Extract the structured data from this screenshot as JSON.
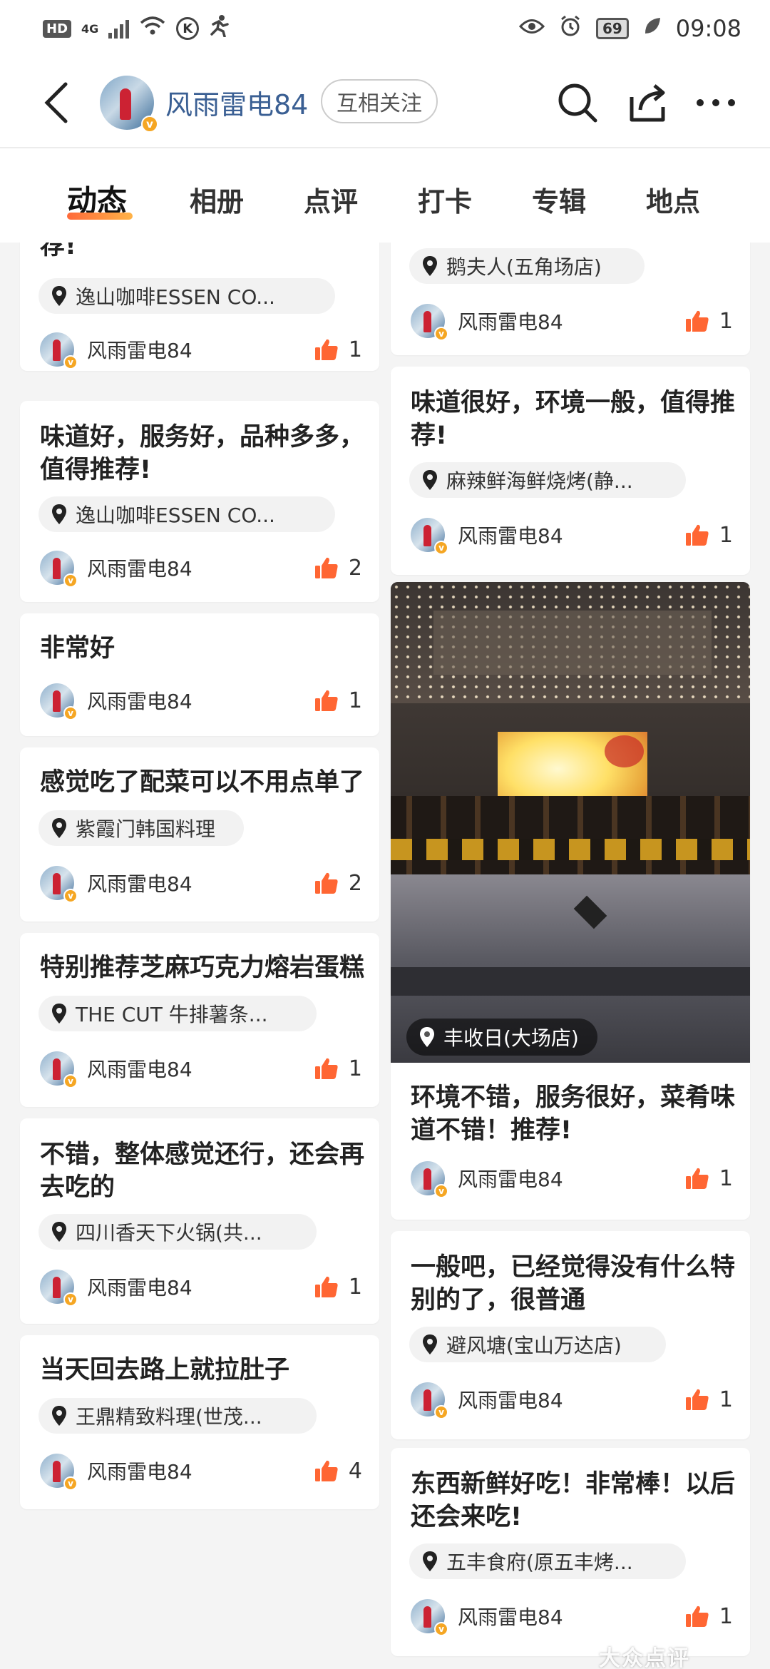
{
  "status_bar": {
    "hd": "HD",
    "network": "4G",
    "battery": "69",
    "time": "09:08"
  },
  "header": {
    "username": "风雨雷电84",
    "follow_status": "互相关注"
  },
  "tabs": [
    "动态",
    "相册",
    "点评",
    "打卡",
    "专辑",
    "地点"
  ],
  "left_column": [
    {
      "title": "荐!",
      "location": "逸山咖啡ESSEN CO...",
      "author": "风雨雷电84",
      "likes": "1"
    },
    {
      "title_line1": "味道好，服务好，品种多多，",
      "title_line2": "值得推荐!",
      "location": "逸山咖啡ESSEN CO...",
      "author": "风雨雷电84",
      "likes": "2"
    },
    {
      "title": "非常好",
      "author": "风雨雷电84",
      "likes": "1"
    },
    {
      "title": "感觉吃了配菜可以不用点单了",
      "location": "紫霞门韩国料理",
      "author": "风雨雷电84",
      "likes": "2"
    },
    {
      "title": "特别推荐芝麻巧克力熔岩蛋糕",
      "location": "THE CUT 牛排薯条...",
      "author": "风雨雷电84",
      "likes": "1"
    },
    {
      "title_line1": "不错，整体感觉还行，还会再",
      "title_line2": "去吃的",
      "location": "四川香天下火锅(共...",
      "author": "风雨雷电84",
      "likes": "1"
    },
    {
      "title": "当天回去路上就拉肚子",
      "location": "王鼎精致料理(世茂...",
      "author": "风雨雷电84",
      "likes": "4"
    }
  ],
  "right_column": [
    {
      "location": "鹅夫人(五角场店)",
      "author": "风雨雷电84",
      "likes": "1"
    },
    {
      "title_line1": "味道很好，环境一般，值得推",
      "title_line2": "荐!",
      "location": "麻辣鲜海鲜烧烤(静...",
      "author": "风雨雷电84",
      "likes": "1"
    },
    {
      "photo_location": "丰收日(大场店)",
      "title_line1": "环境不错，服务很好，菜肴味",
      "title_line2": "道不错！推荐!",
      "author": "风雨雷电84",
      "likes": "1"
    },
    {
      "title_line1": "一般吧，已经觉得没有什么特",
      "title_line2": "别的了，很普通",
      "location": "避风塘(宝山万达店)",
      "author": "风雨雷电84",
      "likes": "1"
    },
    {
      "title_line1": "东西新鲜好吃！非常棒！以后",
      "title_line2": "还会来吃!",
      "location": "五丰食府(原五丰烤...",
      "author": "风雨雷电84",
      "likes": "1"
    }
  ],
  "watermark": "大众点评",
  "colors": {
    "accent": "#ff6633",
    "link": "#3a5f93",
    "badge": "#f5a623"
  }
}
